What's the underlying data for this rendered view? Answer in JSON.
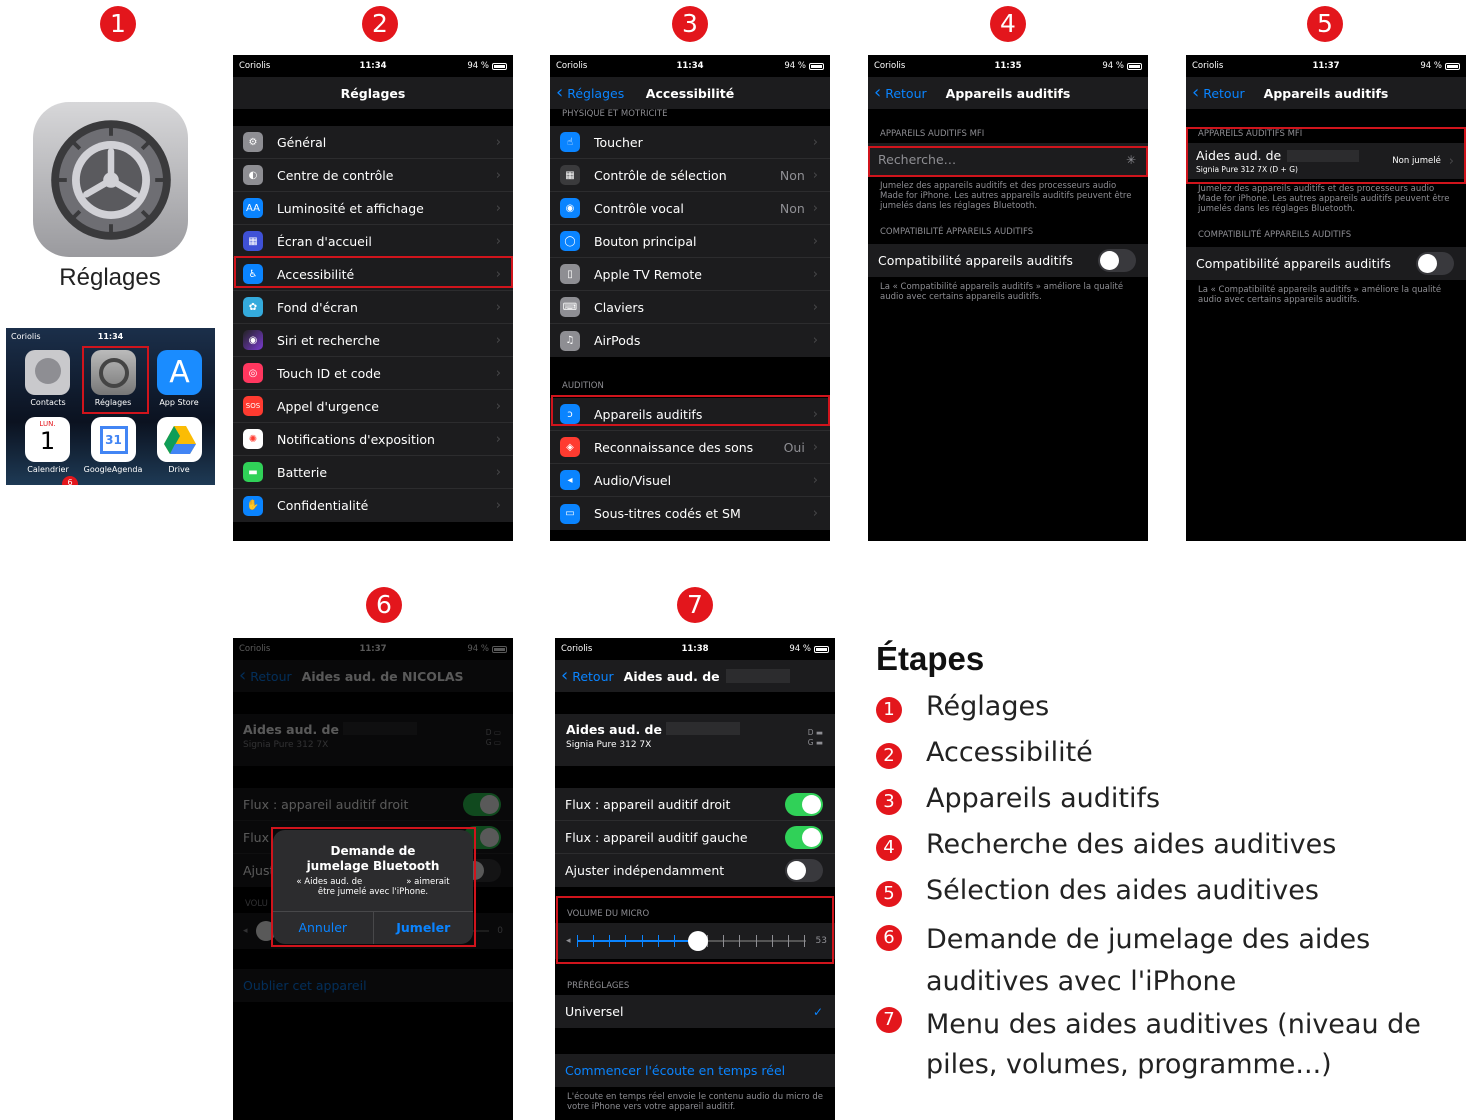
{
  "colors": {
    "accent_red": "#e3161c",
    "ios_blue": "#0a84ff",
    "ios_green": "#30d158"
  },
  "badges": [
    "1",
    "2",
    "3",
    "4",
    "5",
    "6",
    "7"
  ],
  "step1": {
    "app_label": "Réglages",
    "home": {
      "carrier": "Coriolis",
      "time": "11:34",
      "apps": [
        {
          "label": "Contacts"
        },
        {
          "label": "Réglages"
        },
        {
          "label": "App Store"
        },
        {
          "label": "Calendrier",
          "cal_day": "LUN.",
          "cal_num": "1"
        },
        {
          "label": "GoogleAgenda",
          "icon_num": "31"
        },
        {
          "label": "Drive"
        }
      ],
      "notif": "6"
    }
  },
  "step2": {
    "status": {
      "carrier": "Coriolis",
      "time": "11:34",
      "battery": "94 %"
    },
    "title": "Réglages",
    "items": [
      "Général",
      "Centre de contrôle",
      "Luminosité et affichage",
      "Écran d'accueil",
      "Accessibilité",
      "Fond d'écran",
      "Siri et recherche",
      "Touch ID et code",
      "Appel d'urgence",
      "Notifications d'exposition",
      "Batterie",
      "Confidentialité"
    ],
    "icons": {
      "aa": "AA",
      "sos": "SOS"
    }
  },
  "step3": {
    "status": {
      "carrier": "Coriolis",
      "time": "11:34",
      "battery": "94 %"
    },
    "back": "Réglages",
    "title": "Accessibilité",
    "section1": "PHYSIQUE ET MOTRICITÉ",
    "items1": [
      {
        "label": "Toucher",
        "value": ""
      },
      {
        "label": "Contrôle de sélection",
        "value": "Non"
      },
      {
        "label": "Contrôle vocal",
        "value": "Non"
      },
      {
        "label": "Bouton principal",
        "value": ""
      },
      {
        "label": "Apple TV Remote",
        "value": ""
      },
      {
        "label": "Claviers",
        "value": ""
      },
      {
        "label": "AirPods",
        "value": ""
      }
    ],
    "section2": "AUDITION",
    "items2": [
      {
        "label": "Appareils auditifs",
        "value": ""
      },
      {
        "label": "Reconnaissance des sons",
        "value": "Oui"
      },
      {
        "label": "Audio/Visuel",
        "value": ""
      },
      {
        "label": "Sous-titres codés et SM",
        "value": ""
      }
    ]
  },
  "step4": {
    "status": {
      "carrier": "Coriolis",
      "time": "11:35",
      "battery": "94 %"
    },
    "back": "Retour",
    "title": "Appareils auditifs",
    "section1": "APPAREILS AUDITIFS MFI",
    "search": "Recherche…",
    "note1": "Jumelez des appareils auditifs et des processeurs audio Made for iPhone. Les autres appareils auditifs peuvent être jumelés dans les réglages Bluetooth.",
    "section2": "COMPATIBILITÉ APPAREILS AUDITIFS",
    "compat": "Compatibilité appareils auditifs",
    "note2": "La « Compatibilité appareils auditifs » améliore la qualité audio avec certains appareils auditifs."
  },
  "step5": {
    "status": {
      "carrier": "Coriolis",
      "time": "11:37",
      "battery": "94 %"
    },
    "back": "Retour",
    "title": "Appareils auditifs",
    "section1": "APPAREILS AUDITIFS MFI",
    "device": "Aides aud. de",
    "device_sub": "Signia Pure 312 7X (D + G)",
    "device_status": "Non jumelé",
    "note1": "Jumelez des appareils auditifs et des processeurs audio Made for iPhone. Les autres appareils auditifs peuvent être jumelés dans les réglages Bluetooth.",
    "section2": "COMPATIBILITÉ APPAREILS AUDITIFS",
    "compat": "Compatibilité appareils auditifs",
    "note2": "La « Compatibilité appareils auditifs » améliore la qualité audio avec certains appareils auditifs."
  },
  "step6": {
    "status": {
      "carrier": "Coriolis",
      "time": "11:37",
      "battery": "94 %"
    },
    "back": "Retour",
    "title": "Aides aud. de NICOLAS",
    "device": "Aides aud. de",
    "device_sub": "Signia Pure 312 7X",
    "d": "D",
    "g": "G",
    "flux_right": "Flux : appareil auditif droit",
    "flux_left": "Flux",
    "adjust": "Ajust",
    "volume": "VOLU",
    "volume_value": "0",
    "forget": "Oublier cet appareil",
    "dialog": {
      "title": "Demande de jumelage Bluetooth",
      "msg_a": "« Aides aud. de",
      "msg_b": "» aimerait",
      "msg_c": "être jumelé avec l'iPhone.",
      "cancel": "Annuler",
      "pair": "Jumeler"
    }
  },
  "step7": {
    "status": {
      "carrier": "Coriolis",
      "time": "11:38",
      "battery": "94 %"
    },
    "back": "Retour",
    "title": "Aides aud. de",
    "device": "Aides aud. de",
    "device_sub": "Signia Pure 312 7X",
    "d": "D",
    "g": "G",
    "flux_right": "Flux : appareil auditif droit",
    "flux_left": "Flux : appareil auditif gauche",
    "adjust": "Ajuster indépendamment",
    "mic_section": "VOLUME DU MICRO",
    "mic_value": "53",
    "mic_level": 0.53,
    "presets_section": "PRÉRÉGLAGES",
    "preset": "Universel",
    "live": "Commencer l'écoute en temps réel",
    "live_note": "L'écoute en temps réel envoie le contenu audio du micro de votre iPhone vers votre appareil auditif."
  },
  "steps": {
    "title": "Étapes",
    "items": [
      "Réglages",
      "Accessibilité",
      "Appareils auditifs",
      "Recherche des aides auditives",
      "Sélection des aides auditives",
      "Demande de jumelage des aides",
      "auditives avec l'iPhone",
      "Menu des aides auditives (niveau de",
      "piles, volumes, programme...)"
    ]
  }
}
